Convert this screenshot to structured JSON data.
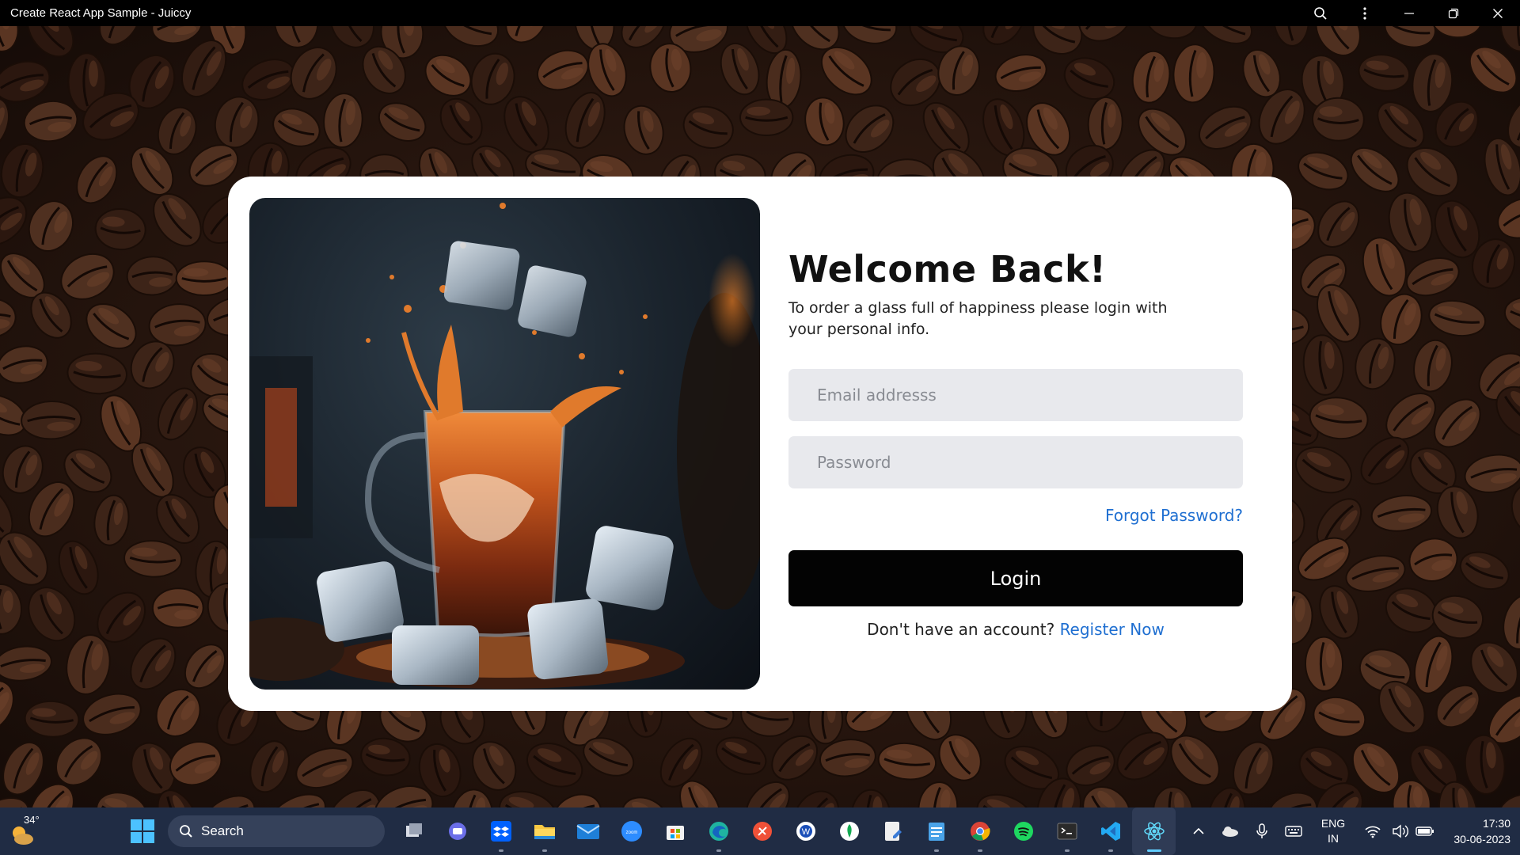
{
  "window": {
    "title": "Create React App Sample - Juiccy",
    "buttons": [
      "zoom-icon",
      "more-icon",
      "minimize-icon",
      "restore-icon",
      "close-icon"
    ]
  },
  "login": {
    "heading": "Welcome Back!",
    "subtitle": "To order a glass full of happiness please login with your personal info.",
    "email_placeholder": "Email addresss",
    "password_placeholder": "Password",
    "forgot_label": "Forgot Password?",
    "login_label": "Login",
    "register_prompt": "Don't have an account?",
    "register_link": "Register Now",
    "link_color": "#1f6fd1",
    "button_color": "#030303"
  },
  "taskbar": {
    "weather_temp": "34°",
    "search_label": "Search",
    "apps": [
      "task-view",
      "teams",
      "dropbox",
      "file-explorer",
      "mail",
      "zoom",
      "microsoft-store",
      "edge",
      "swift",
      "word-app",
      "mongodb-compass",
      "notepad-doc",
      "notepad",
      "chrome",
      "spotify",
      "terminal",
      "vscode",
      "react-devtools"
    ],
    "lang_line1": "ENG",
    "lang_line2": "IN",
    "time": "17:30",
    "date": "30-06-2023"
  }
}
